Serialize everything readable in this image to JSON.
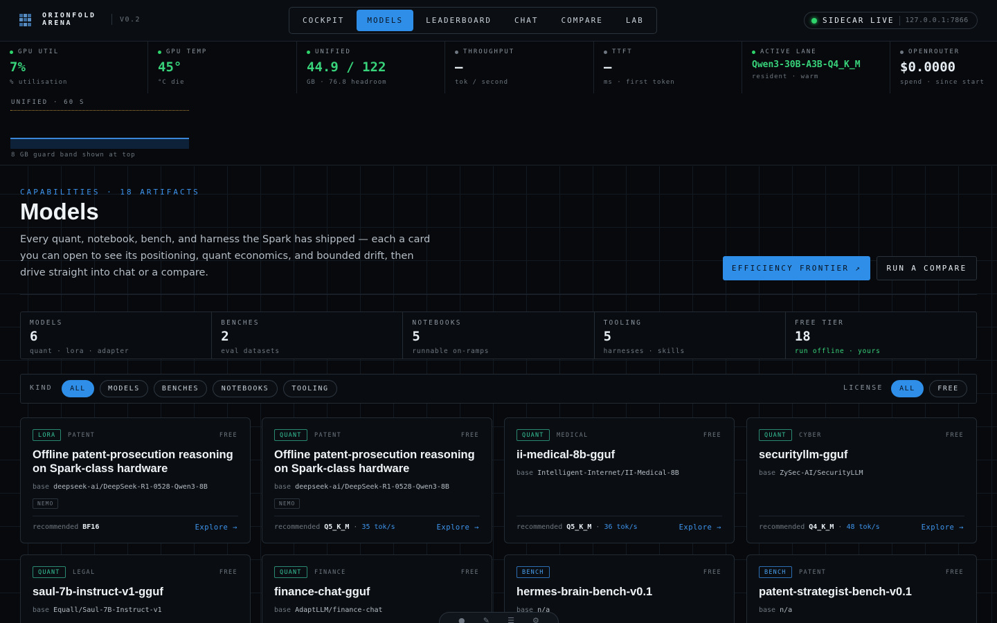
{
  "brand": {
    "line1": "ORIONFOLD",
    "line2": "ARENA",
    "version": "V0.2"
  },
  "nav": {
    "tabs": [
      {
        "label": "COCKPIT",
        "active": false
      },
      {
        "label": "MODELS",
        "active": true
      },
      {
        "label": "LEADERBOARD",
        "active": false
      },
      {
        "label": "CHAT",
        "active": false
      },
      {
        "label": "COMPARE",
        "active": false
      },
      {
        "label": "LAB",
        "active": false
      }
    ]
  },
  "sidecar": {
    "status": "SIDECAR LIVE",
    "address": "127.0.0.1:7866",
    "status_color": "#2fd36b"
  },
  "metrics": [
    {
      "label": "GPU UTIL",
      "value": "7%",
      "sub": "% utilisation"
    },
    {
      "label": "GPU TEMP",
      "value": "45°",
      "sub": "°C die"
    },
    {
      "label": "UNIFIED",
      "value": "44.9 / 122",
      "sub": "GB · 76.8 headroom"
    },
    {
      "label": "THROUGHPUT",
      "value": "—",
      "sub": "tok / second"
    },
    {
      "label": "TTFT",
      "value": "—",
      "sub": "ms · first token"
    },
    {
      "label": "ACTIVE LANE",
      "value": "Qwen3-30B-A3B-Q4_K_M",
      "sub": "resident · warm"
    },
    {
      "label": "OPENROUTER",
      "value": "$0.0000",
      "sub": "spend · since start"
    }
  ],
  "unified_chart": {
    "label": "UNIFIED · 60 S",
    "note": "8 GB guard band shown at top",
    "used_gb": 44.9,
    "total_gb": 122,
    "guard_gb": 8
  },
  "page": {
    "eyebrow": "CAPABILITIES · 18 ARTIFACTS",
    "title": "Models",
    "description": "Every quant, notebook, bench, and harness the Spark has shipped — each a card you can open to see its positioning, quant economics, and bounded drift, then drive straight into chat or a compare.",
    "frontier_button": "EFFICIENCY FRONTIER ↗",
    "compare_button": "RUN A COMPARE"
  },
  "stats": [
    {
      "label": "MODELS",
      "value": "6",
      "sub": "quant · lora · adapter"
    },
    {
      "label": "BENCHES",
      "value": "2",
      "sub": "eval datasets"
    },
    {
      "label": "NOTEBOOKS",
      "value": "5",
      "sub": "runnable on-ramps"
    },
    {
      "label": "TOOLING",
      "value": "5",
      "sub": "harnesses · skills"
    },
    {
      "label": "FREE TIER",
      "value": "18",
      "sub": "run offline · yours"
    }
  ],
  "filters": {
    "kind_label": "KIND",
    "kind_chips": [
      "ALL",
      "MODELS",
      "BENCHES",
      "NOTEBOOKS",
      "TOOLING"
    ],
    "license_label": "LICENSE",
    "license_chips": [
      "ALL",
      "FREE"
    ]
  },
  "cards": [
    {
      "tag": "LORA",
      "domain": "PATENT",
      "license": "FREE",
      "title": "Offline patent-prosecution reasoning on Spark-class hardware",
      "base_label": "base",
      "base": "deepseek-ai/DeepSeek-R1-0528-Qwen3-8B",
      "badge": "NEMO",
      "rec_label": "recommended",
      "quant": "BF16",
      "tps": "",
      "explore": "Explore →"
    },
    {
      "tag": "QUANT",
      "domain": "PATENT",
      "license": "FREE",
      "title": "Offline patent-prosecution reasoning on Spark-class hardware",
      "base_label": "base",
      "base": "deepseek-ai/DeepSeek-R1-0528-Qwen3-8B",
      "badge": "NEMO",
      "rec_label": "recommended",
      "quant": "Q5_K_M",
      "tps": "35 tok/s",
      "explore": "Explore →"
    },
    {
      "tag": "QUANT",
      "domain": "MEDICAL",
      "license": "FREE",
      "title": "ii-medical-8b-gguf",
      "base_label": "base",
      "base": "Intelligent-Internet/II-Medical-8B",
      "badge": "",
      "rec_label": "recommended",
      "quant": "Q5_K_M",
      "tps": "36 tok/s",
      "explore": "Explore →"
    },
    {
      "tag": "QUANT",
      "domain": "CYBER",
      "license": "FREE",
      "title": "securityllm-gguf",
      "base_label": "base",
      "base": "ZySec-AI/SecurityLLM",
      "badge": "",
      "rec_label": "recommended",
      "quant": "Q4_K_M",
      "tps": "48 tok/s",
      "explore": "Explore →"
    },
    {
      "tag": "QUANT",
      "domain": "LEGAL",
      "license": "FREE",
      "title": "saul-7b-instruct-v1-gguf",
      "base_label": "base",
      "base": "Equall/Saul-7B-Instruct-v1"
    },
    {
      "tag": "QUANT",
      "domain": "FINANCE",
      "license": "FREE",
      "title": "finance-chat-gguf",
      "base_label": "base",
      "base": "AdaptLLM/finance-chat"
    },
    {
      "tag": "BENCH",
      "domain": "",
      "license": "FREE",
      "title": "hermes-brain-bench-v0.1",
      "base_label": "base",
      "base": "n/a"
    },
    {
      "tag": "BENCH",
      "domain": "PATENT",
      "license": "FREE",
      "title": "patent-strategist-bench-v0.1",
      "base_label": "base",
      "base": "n/a"
    }
  ],
  "dock": {
    "icons": [
      "person-icon",
      "brush-icon",
      "menu-icon",
      "gear-icon"
    ]
  }
}
